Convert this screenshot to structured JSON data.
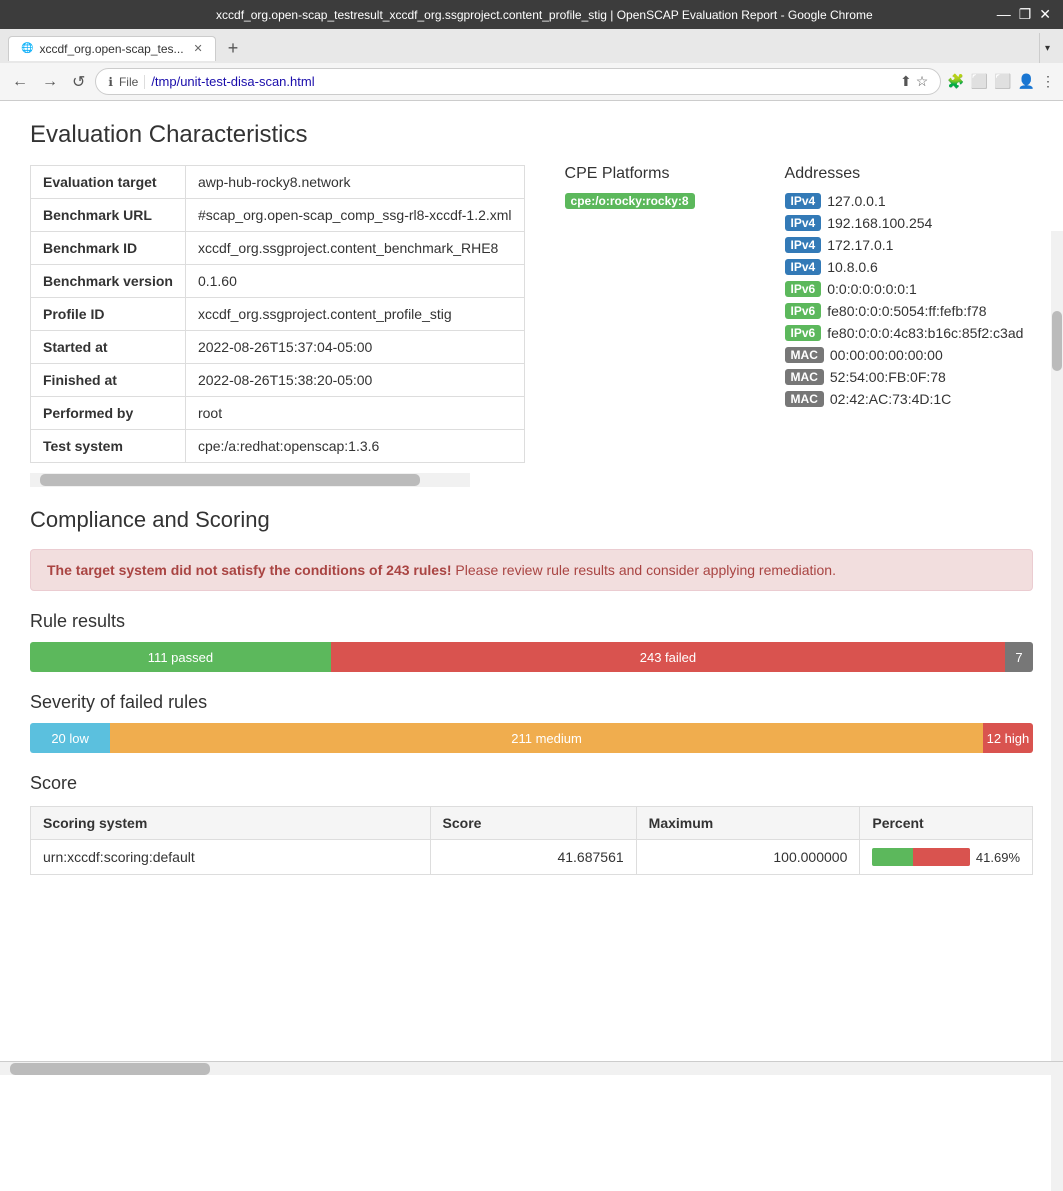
{
  "browser": {
    "titlebar": {
      "title": "xccdf_org.open-scap_testresult_xccdf_org.ssgproject.content_profile_stig | OpenSCAP Evaluation Report - Google Chrome",
      "minimize": "—",
      "maximize": "❐",
      "close": "✕"
    },
    "tab": {
      "favicon": "🔵",
      "label": "xccdf_org.open-scap_tes...",
      "close": "✕"
    },
    "new_tab": "+",
    "addressbar": {
      "back": "←",
      "forward": "→",
      "reload": "↺",
      "lock_icon": "🔒",
      "file_label": "File",
      "address": "/tmp/unit-test-disa-scan.html",
      "share": "⬆",
      "bookmark": "☆",
      "extensions": "🧩",
      "cast": "📺",
      "screenshot": "⬜",
      "profile": "👤",
      "menu": "⋮"
    },
    "tabs_arrow": "›"
  },
  "page": {
    "eval_characteristics": {
      "title": "Evaluation Characteristics",
      "rows": [
        {
          "label": "Evaluation target",
          "value": "awp-hub-rocky8.network"
        },
        {
          "label": "Benchmark URL",
          "value": "#scap_org.open-scap_comp_ssg-rl8-xccdf-1.2.xml"
        },
        {
          "label": "Benchmark ID",
          "value": "xccdf_org.ssgproject.content_benchmark_RHE8"
        },
        {
          "label": "Benchmark version",
          "value": "0.1.60"
        },
        {
          "label": "Profile ID",
          "value": "xccdf_org.ssgproject.content_profile_stig"
        },
        {
          "label": "Started at",
          "value": "2022-08-26T15:37:04-05:00"
        },
        {
          "label": "Finished at",
          "value": "2022-08-26T15:38:20-05:00"
        },
        {
          "label": "Performed by",
          "value": "root"
        },
        {
          "label": "Test system",
          "value": "cpe:/a:redhat:openscap:1.3.6"
        }
      ]
    },
    "cpe_platforms": {
      "title": "CPE Platforms",
      "items": [
        {
          "badge": "cpe:/o:rocky:rocky:8",
          "badge_type": "cpe"
        }
      ]
    },
    "addresses": {
      "title": "Addresses",
      "items": [
        {
          "type": "IPv4",
          "value": "127.0.0.1"
        },
        {
          "type": "IPv4",
          "value": "192.168.100.254"
        },
        {
          "type": "IPv4",
          "value": "172.17.0.1"
        },
        {
          "type": "IPv4",
          "value": "10.8.0.6"
        },
        {
          "type": "IPv6",
          "value": "0:0:0:0:0:0:0:1"
        },
        {
          "type": "IPv6",
          "value": "fe80:0:0:0:5054:ff:fefb:f78"
        },
        {
          "type": "IPv6",
          "value": "fe80:0:0:0:4c83:b16c:85f2:c3ad"
        },
        {
          "type": "MAC",
          "value": "00:00:00:00:00:00"
        },
        {
          "type": "MAC",
          "value": "52:54:00:FB:0F:78"
        },
        {
          "type": "MAC",
          "value": "02:42:AC:73:4D:1C"
        }
      ]
    },
    "compliance": {
      "title": "Compliance and Scoring",
      "alert": "The target system did not satisfy the conditions of 243 rules!",
      "alert_suffix": " Please review rule results and consider applying remediation.",
      "rule_results": {
        "title": "Rule results",
        "passed": {
          "label": "111 passed",
          "percent": 30
        },
        "failed": {
          "label": "243 failed",
          "percent": 66
        },
        "other": {
          "label": "7",
          "percent": 4
        }
      },
      "severity": {
        "title": "Severity of failed rules",
        "low": {
          "label": "20 low",
          "percent": 8
        },
        "medium": {
          "label": "211 medium",
          "percent": 87
        },
        "high": {
          "label": "12 high",
          "percent": 5
        }
      },
      "score": {
        "title": "Score",
        "columns": [
          "Scoring system",
          "Score",
          "Maximum",
          "Percent"
        ],
        "rows": [
          {
            "system": "urn:xccdf:scoring:default",
            "score": "41.687561",
            "maximum": "100.000000",
            "percent": 41.69,
            "percent_label": "41.69%"
          }
        ]
      }
    }
  },
  "colors": {
    "ipv4": "#337ab7",
    "ipv6": "#5cb85c",
    "mac": "#777777",
    "cpe": "#5cb85c",
    "passed": "#5cb85c",
    "failed": "#d9534f",
    "low": "#5bc0de",
    "medium": "#f0ad4e",
    "high": "#d9534f"
  }
}
